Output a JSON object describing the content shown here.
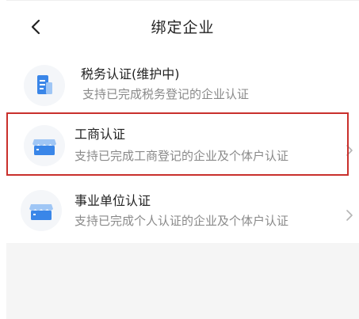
{
  "header": {
    "title": "绑定企业",
    "back_icon": "chevron-left-icon"
  },
  "items": [
    {
      "title": "税务认证(维护中)",
      "subtitle": "支持已完成税务登记的企业认证",
      "icon": "tax-document-icon",
      "has_chevron": false
    },
    {
      "title": "工商认证",
      "subtitle": "支持已完成工商登记的企业及个体户认证",
      "icon": "storefront-icon",
      "has_chevron": true
    },
    {
      "title": "事业单位认证",
      "subtitle": "支持已完成个人认证的企业及个体户认证",
      "icon": "storefront-icon",
      "has_chevron": true
    }
  ],
  "colors": {
    "accent_blue": "#3a86e8",
    "highlight_red": "#c9302c"
  }
}
